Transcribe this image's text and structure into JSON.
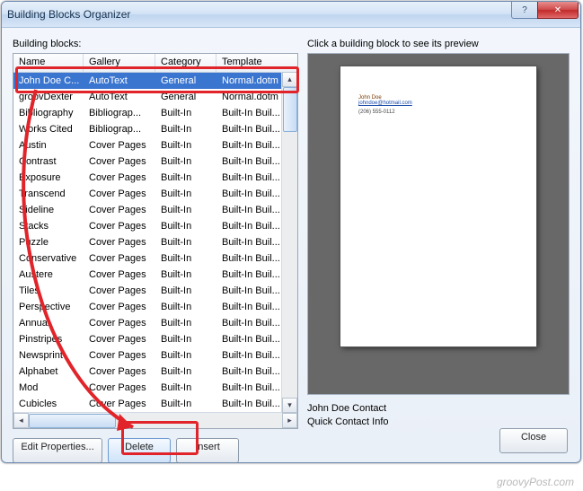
{
  "window": {
    "title": "Building Blocks Organizer",
    "help_glyph": "?",
    "close_glyph": "✕"
  },
  "left": {
    "label": "Building blocks:",
    "columns": {
      "name": "Name",
      "gallery": "Gallery",
      "category": "Category",
      "template": "Template"
    },
    "rows": [
      {
        "name": "John Doe C...",
        "gallery": "AutoText",
        "category": "General",
        "template": "Normal.dotm",
        "selected": true
      },
      {
        "name": "groovDexter",
        "gallery": "AutoText",
        "category": "General",
        "template": "Normal.dotm"
      },
      {
        "name": "Bibliography",
        "gallery": "Bibliograp...",
        "category": "Built-In",
        "template": "Built-In Buil..."
      },
      {
        "name": "Works Cited",
        "gallery": "Bibliograp...",
        "category": "Built-In",
        "template": "Built-In Buil..."
      },
      {
        "name": "Austin",
        "gallery": "Cover Pages",
        "category": "Built-In",
        "template": "Built-In Buil..."
      },
      {
        "name": "Contrast",
        "gallery": "Cover Pages",
        "category": "Built-In",
        "template": "Built-In Buil..."
      },
      {
        "name": "Exposure",
        "gallery": "Cover Pages",
        "category": "Built-In",
        "template": "Built-In Buil..."
      },
      {
        "name": "Transcend",
        "gallery": "Cover Pages",
        "category": "Built-In",
        "template": "Built-In Buil..."
      },
      {
        "name": "Sideline",
        "gallery": "Cover Pages",
        "category": "Built-In",
        "template": "Built-In Buil..."
      },
      {
        "name": "Stacks",
        "gallery": "Cover Pages",
        "category": "Built-In",
        "template": "Built-In Buil..."
      },
      {
        "name": "Puzzle",
        "gallery": "Cover Pages",
        "category": "Built-In",
        "template": "Built-In Buil..."
      },
      {
        "name": "Conservative",
        "gallery": "Cover Pages",
        "category": "Built-In",
        "template": "Built-In Buil..."
      },
      {
        "name": "Austere",
        "gallery": "Cover Pages",
        "category": "Built-In",
        "template": "Built-In Buil..."
      },
      {
        "name": "Tiles",
        "gallery": "Cover Pages",
        "category": "Built-In",
        "template": "Built-In Buil..."
      },
      {
        "name": "Perspective",
        "gallery": "Cover Pages",
        "category": "Built-In",
        "template": "Built-In Buil..."
      },
      {
        "name": "Annual",
        "gallery": "Cover Pages",
        "category": "Built-In",
        "template": "Built-In Buil..."
      },
      {
        "name": "Pinstripes",
        "gallery": "Cover Pages",
        "category": "Built-In",
        "template": "Built-In Buil..."
      },
      {
        "name": "Newsprint",
        "gallery": "Cover Pages",
        "category": "Built-In",
        "template": "Built-In Buil..."
      },
      {
        "name": "Alphabet",
        "gallery": "Cover Pages",
        "category": "Built-In",
        "template": "Built-In Buil..."
      },
      {
        "name": "Mod",
        "gallery": "Cover Pages",
        "category": "Built-In",
        "template": "Built-In Buil..."
      },
      {
        "name": "Cubicles",
        "gallery": "Cover Pages",
        "category": "Built-In",
        "template": "Built-In Buil..."
      }
    ],
    "buttons": {
      "edit": "Edit Properties...",
      "delete": "Delete",
      "insert": "Insert"
    },
    "scroll": {
      "left_glyph": "◂",
      "right_glyph": "▸",
      "up_glyph": "▴",
      "down_glyph": "▾"
    }
  },
  "right": {
    "label": "Click a building block to see its preview",
    "preview": {
      "name": "John Doe",
      "email": "johndoe@hotmail.com",
      "phone": "(206) 555-0112"
    },
    "info": {
      "line1": "John Doe Contact",
      "line2": "Quick Contact Info"
    }
  },
  "footer": {
    "close": "Close"
  },
  "watermark": "groovyPost.com"
}
